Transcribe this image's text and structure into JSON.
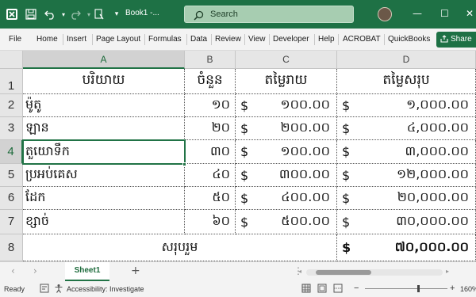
{
  "titlebar": {
    "title": "Book1 -...",
    "search_label": "Search",
    "colors": {
      "bar": "#1e7145"
    }
  },
  "menu": {
    "items": [
      "File",
      "Home",
      "Insert",
      "Page Layout",
      "Formulas",
      "Data",
      "Review",
      "View",
      "Developer",
      "Help",
      "ACROBAT",
      "QuickBooks"
    ],
    "share_label": "Share"
  },
  "grid": {
    "columns": [
      "A",
      "B",
      "C",
      "D"
    ],
    "rows": [
      "1",
      "2",
      "3",
      "4",
      "5",
      "6",
      "7",
      "8"
    ],
    "header": {
      "a": "បរិយាយ",
      "b": "ចំនួន",
      "c": "តម្លៃរាយ",
      "d": "តម្លៃសរុប"
    },
    "data": [
      {
        "item": "ម៉ូតូ",
        "qty": "១០",
        "price_sym": "$",
        "price": "១០០.០០",
        "total_sym": "$",
        "total": "១,០០០.០០"
      },
      {
        "item": "ឡាន",
        "qty": "២០",
        "price_sym": "$",
        "price": "២០០.០០",
        "total_sym": "$",
        "total": "៤,០០០.០០"
      },
      {
        "item": "តួយោទឹក",
        "qty": "៣០",
        "price_sym": "$",
        "price": "១០០.០០",
        "total_sym": "$",
        "total": "៣,០០០.០០"
      },
      {
        "item": "ប្រអប់គេស",
        "qty": "៤០",
        "price_sym": "$",
        "price": "៣០០.០០",
        "total_sym": "$",
        "total": "១២,០០០.០០"
      },
      {
        "item": "ដែក",
        "qty": "៥០",
        "price_sym": "$",
        "price": "៤០០.០០",
        "total_sym": "$",
        "total": "២០,០០០.០០"
      },
      {
        "item": "ខ្សាច់",
        "qty": "៦០",
        "price_sym": "$",
        "price": "៥០០.០០",
        "total_sym": "$",
        "total": "៣០,០០០.០០"
      }
    ],
    "total_row": {
      "label": "សរុបរួម",
      "sym": "$",
      "amount": "៧០,០០០.០០"
    },
    "active_cell": "A4"
  },
  "sheets": {
    "tabs": [
      "Sheet1"
    ]
  },
  "status": {
    "ready": "Ready",
    "accessibility": "Accessibility: Investigate",
    "zoom": "160%"
  }
}
